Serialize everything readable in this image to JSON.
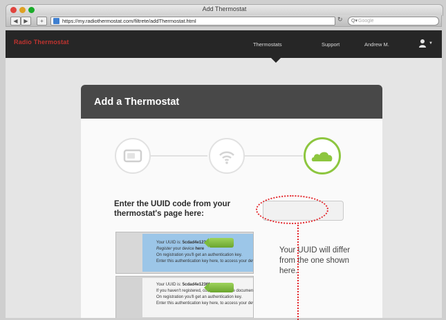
{
  "window": {
    "title": "Add Thermostat"
  },
  "browser": {
    "url": "https://my.radiothermostat.com/filtrete/addThermostat.html",
    "search_placeholder": "Google"
  },
  "site": {
    "logo": "Radio Thermostat",
    "nav": {
      "thermostats": "Thermostats",
      "support": "Support",
      "user": "Andrew M."
    }
  },
  "card": {
    "title": "Add a Thermostat",
    "steps": [
      {
        "icon": "thermostat-icon",
        "state": "complete"
      },
      {
        "icon": "wifi-icon",
        "state": "complete"
      },
      {
        "icon": "cloud-icon",
        "state": "current"
      }
    ],
    "prompt": "Enter the UUID code from your thermostat's page here:",
    "uuid_value": ""
  },
  "annotation": {
    "note": "Your UUID will differ from the one shown here.",
    "color": "#e3262b"
  },
  "samples": {
    "shot1": {
      "uuid_label": "Your UUID is:",
      "uuid": "5cdad4e1236f",
      "register_prefix": "Register",
      "register_middle": " your device ",
      "register_link": "here",
      "line3": "On registration you'll get an authentication key.",
      "line4": "Enter this authentication key here, to access your device."
    },
    "shot2": {
      "uuid_label": "Your UUID is:",
      "uuid": "5cdad4e1236f",
      "line2": "If you haven't registered, consult the online documentation.",
      "line3": "On registration you'll get an authentication key.",
      "line4": "Enter this authentication key here, to access your device."
    }
  },
  "colors": {
    "accent": "#8dc63f",
    "header": "#262626",
    "logo_red": "#c0332f"
  }
}
